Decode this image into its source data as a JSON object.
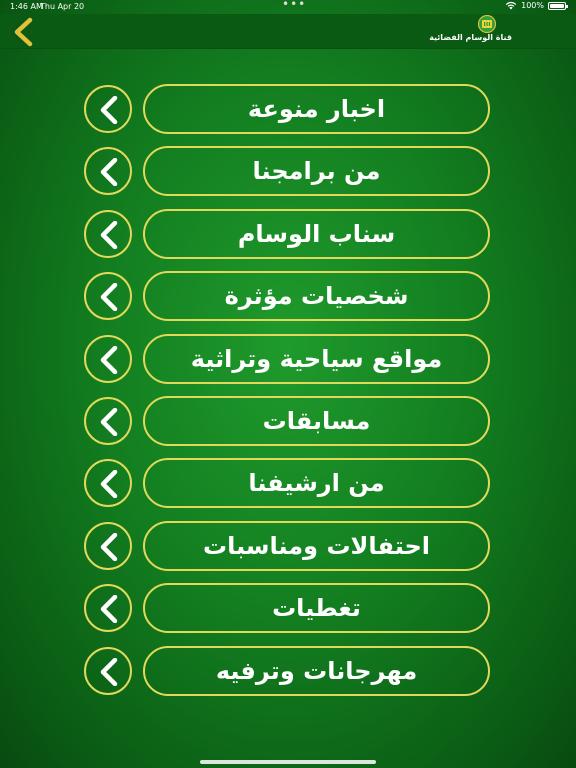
{
  "status_bar": {
    "time": "1:46 AM",
    "date": "Thu Apr 20",
    "battery": "100%",
    "multitask_dots": "•••"
  },
  "header": {
    "logo_text": "قناة الوسام الفضائية",
    "back_icon": "chevron-left-icon"
  },
  "colors": {
    "accent_gold": "#e2d95b",
    "background_green": "#137e20",
    "nav_green": "#0b5a13"
  },
  "menu": {
    "items": [
      {
        "label": "اخبار منوعة"
      },
      {
        "label": "من برامجنا"
      },
      {
        "label": "سناب الوسام"
      },
      {
        "label": "شخصيات مؤثرة"
      },
      {
        "label": "مواقع سياحية وتراثية"
      },
      {
        "label": "مسابقات"
      },
      {
        "label": "من ارشيفنا"
      },
      {
        "label": "احتفالات ومناسبات"
      },
      {
        "label": "تغطيات"
      },
      {
        "label": "مهرجانات وترفيه"
      }
    ]
  }
}
